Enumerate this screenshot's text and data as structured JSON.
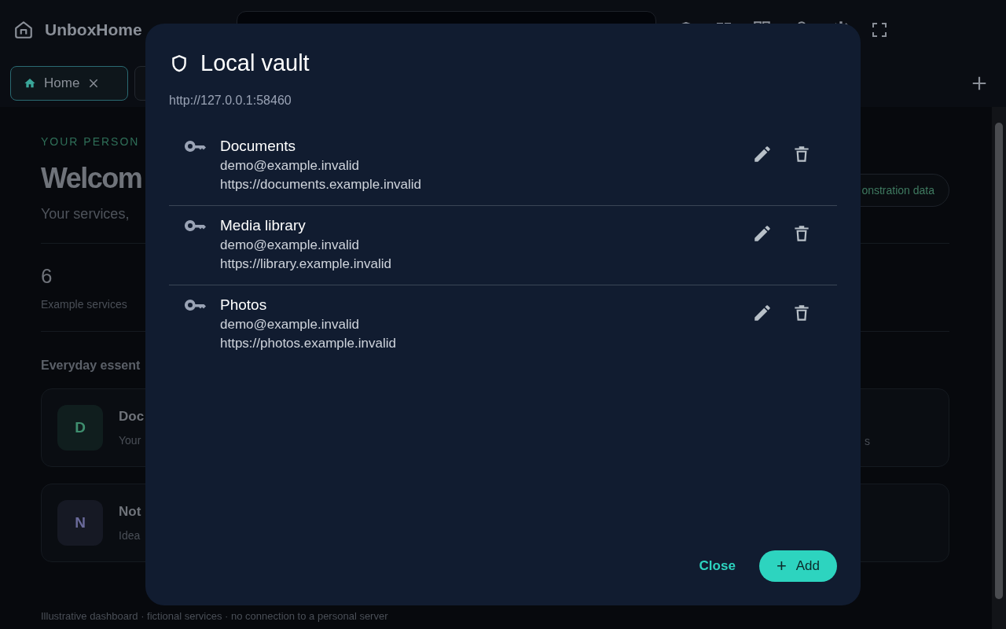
{
  "app": {
    "brand": "UnboxHome"
  },
  "tabs": [
    {
      "label": "Home",
      "selected": true
    }
  ],
  "page": {
    "eyebrow": "YOUR PERSON",
    "heading": "Welcom",
    "subtitle": "Your services,",
    "demo_chip": "onstration data",
    "stat": {
      "value": "6",
      "label": "Example services"
    },
    "section": "Everyday essent",
    "cards": [
      {
        "initial": "D",
        "title": "Doc",
        "text": "Your",
        "tail": "s",
        "color": "#3f8f6f"
      },
      {
        "initial": "N",
        "title": "Not",
        "text": "Idea",
        "color": "#6a6a9a"
      }
    ],
    "footer": "Illustrative dashboard · fictional services · no connection to a personal server"
  },
  "dialog": {
    "title": "Local vault",
    "url": "http://127.0.0.1:58460",
    "entries": [
      {
        "name": "Documents",
        "user": "demo@example.invalid",
        "site": "https://documents.example.invalid"
      },
      {
        "name": "Media library",
        "user": "demo@example.invalid",
        "site": "https://library.example.invalid"
      },
      {
        "name": "Photos",
        "user": "demo@example.invalid",
        "site": "https://photos.example.invalid"
      }
    ],
    "buttons": [
      {
        "kind": "text",
        "label": "Close"
      },
      {
        "kind": "primary",
        "icon": "+",
        "label": "Add"
      }
    ]
  }
}
